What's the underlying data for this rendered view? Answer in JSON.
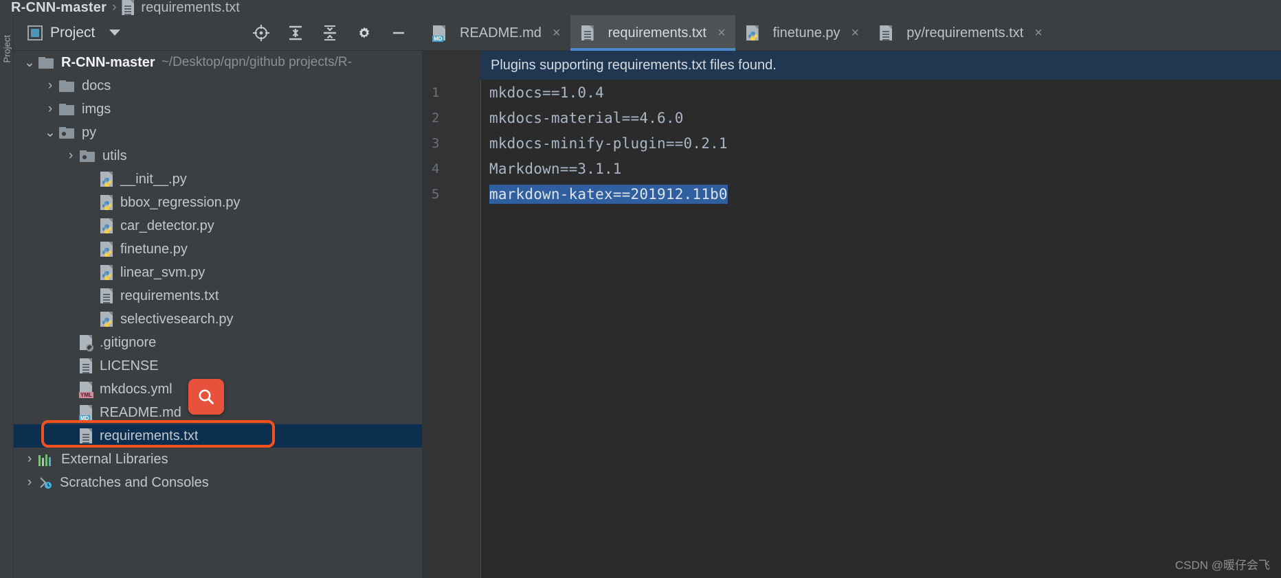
{
  "breadcrumb": {
    "project": "R-CNN-master",
    "separator": "›",
    "file": "requirements.txt",
    "file_icon": "txt-file-icon"
  },
  "left_stripe": {
    "label": "Project"
  },
  "project_panel": {
    "title": "Project",
    "icon": "project-window-icon",
    "dropdown_icon": "chevron-down-icon",
    "tools": [
      {
        "name": "locate-in-tree-icon",
        "label": "Select Opened File"
      },
      {
        "name": "expand-all-icon",
        "label": "Expand All"
      },
      {
        "name": "collapse-all-icon",
        "label": "Collapse All"
      },
      {
        "name": "gear-icon",
        "label": "Settings"
      },
      {
        "name": "minimize-icon",
        "label": "Hide"
      }
    ]
  },
  "tree": {
    "items": [
      {
        "label": "R-CNN-master",
        "suffix": "~/Desktop/qpn/github projects/R-",
        "icon": "folder-icon",
        "chevron": "expanded",
        "indent": 0,
        "bold": true,
        "selected": false
      },
      {
        "label": "docs",
        "suffix": "",
        "icon": "folder-icon",
        "chevron": "collapsed",
        "indent": 1,
        "bold": false,
        "selected": false
      },
      {
        "label": "imgs",
        "suffix": "",
        "icon": "folder-icon",
        "chevron": "collapsed",
        "indent": 1,
        "bold": false,
        "selected": false
      },
      {
        "label": "py",
        "suffix": "",
        "icon": "source-folder-icon",
        "chevron": "expanded",
        "indent": 1,
        "bold": false,
        "selected": false
      },
      {
        "label": "utils",
        "suffix": "",
        "icon": "source-folder-icon",
        "chevron": "collapsed",
        "indent": 2,
        "bold": false,
        "selected": false
      },
      {
        "label": "__init__.py",
        "suffix": "",
        "icon": "python-file-icon",
        "chevron": "none",
        "indent": 3,
        "bold": false,
        "selected": false
      },
      {
        "label": "bbox_regression.py",
        "suffix": "",
        "icon": "python-file-icon",
        "chevron": "none",
        "indent": 3,
        "bold": false,
        "selected": false
      },
      {
        "label": "car_detector.py",
        "suffix": "",
        "icon": "python-file-icon",
        "chevron": "none",
        "indent": 3,
        "bold": false,
        "selected": false
      },
      {
        "label": "finetune.py",
        "suffix": "",
        "icon": "python-file-icon",
        "chevron": "none",
        "indent": 3,
        "bold": false,
        "selected": false
      },
      {
        "label": "linear_svm.py",
        "suffix": "",
        "icon": "python-file-icon",
        "chevron": "none",
        "indent": 3,
        "bold": false,
        "selected": false
      },
      {
        "label": "requirements.txt",
        "suffix": "",
        "icon": "txt-file-icon",
        "chevron": "none",
        "indent": 3,
        "bold": false,
        "selected": false
      },
      {
        "label": "selectivesearch.py",
        "suffix": "",
        "icon": "python-file-icon",
        "chevron": "none",
        "indent": 3,
        "bold": false,
        "selected": false
      },
      {
        "label": ".gitignore",
        "suffix": "",
        "icon": "gitignore-file-icon",
        "chevron": "none",
        "indent": 2,
        "bold": false,
        "selected": false
      },
      {
        "label": "LICENSE",
        "suffix": "",
        "icon": "txt-file-icon",
        "chevron": "none",
        "indent": 2,
        "bold": false,
        "selected": false
      },
      {
        "label": "mkdocs.yml",
        "suffix": "",
        "icon": "yml-file-icon",
        "chevron": "none",
        "indent": 2,
        "bold": false,
        "selected": false
      },
      {
        "label": "README.md",
        "suffix": "",
        "icon": "markdown-file-icon",
        "chevron": "none",
        "indent": 2,
        "bold": false,
        "selected": false
      },
      {
        "label": "requirements.txt",
        "suffix": "",
        "icon": "txt-file-icon",
        "chevron": "none",
        "indent": 2,
        "bold": false,
        "selected": true
      },
      {
        "label": "External Libraries",
        "suffix": "",
        "icon": "external-libraries-icon",
        "chevron": "collapsed",
        "indent": 0,
        "bold": false,
        "selected": false
      },
      {
        "label": "Scratches and Consoles",
        "suffix": "",
        "icon": "scratches-icon",
        "chevron": "collapsed",
        "indent": 0,
        "bold": false,
        "selected": false
      }
    ]
  },
  "annotations": {
    "highlight_rect": {
      "name": "requirements-txt-highlight-rect",
      "color": "#f4511e"
    },
    "search_badge": {
      "name": "search-icon-badge",
      "color": "#e8513c",
      "icon": "magnifier-icon"
    }
  },
  "editor": {
    "tabs": [
      {
        "label": "README.md",
        "icon": "markdown-file-icon",
        "active": false,
        "close_icon": "×"
      },
      {
        "label": "requirements.txt",
        "icon": "txt-file-icon",
        "active": true,
        "close_icon": "×"
      },
      {
        "label": "finetune.py",
        "icon": "python-file-icon",
        "active": false,
        "close_icon": "×"
      },
      {
        "label": "py/requirements.txt",
        "icon": "txt-file-icon",
        "active": false,
        "close_icon": "×"
      }
    ],
    "notification": {
      "text": "Plugins supporting requirements.txt files found.",
      "background": "#1f3750"
    },
    "lines": [
      {
        "number": "1",
        "text": "mkdocs==1.0.4",
        "selected": false
      },
      {
        "number": "2",
        "text": "mkdocs-material==4.6.0",
        "selected": false
      },
      {
        "number": "3",
        "text": "mkdocs-minify-plugin==0.2.1",
        "selected": false
      },
      {
        "number": "4",
        "text": "Markdown==3.1.1",
        "selected": false
      },
      {
        "number": "5",
        "text": "markdown-katex==201912.11b0",
        "selected": true
      }
    ],
    "selection_color": "#2f5f9e"
  },
  "watermark": {
    "text": "CSDN @暖仔会飞"
  }
}
